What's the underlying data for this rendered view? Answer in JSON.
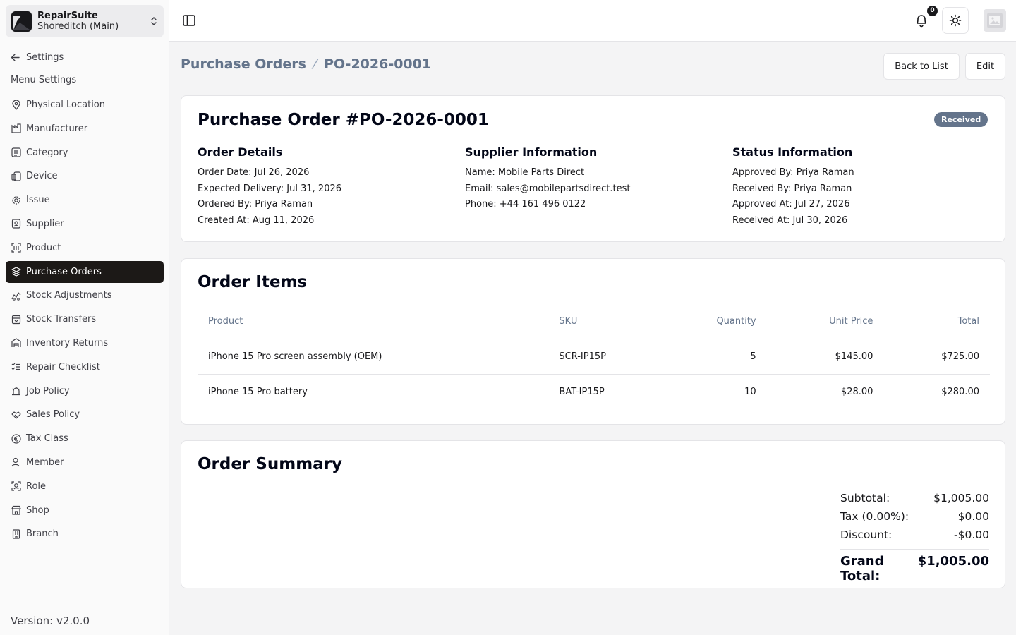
{
  "shop": {
    "name": "RepairSuite",
    "branch": "Shoreditch (Main)"
  },
  "sidebar": {
    "back_label": "Settings",
    "menu_heading": "Menu Settings",
    "items": [
      {
        "label": "Physical Location",
        "icon": "map-pin-icon"
      },
      {
        "label": "Manufacturer",
        "icon": "factory-icon"
      },
      {
        "label": "Category",
        "icon": "list-icon"
      },
      {
        "label": "Device",
        "icon": "device-icon"
      },
      {
        "label": "Issue",
        "icon": "gear-icon"
      },
      {
        "label": "Supplier",
        "icon": "contact-icon"
      },
      {
        "label": "Product",
        "icon": "barcode-icon"
      },
      {
        "label": "Purchase Orders",
        "icon": "layers-icon",
        "active": true
      },
      {
        "label": "Stock Adjustments",
        "icon": "adjust-icon"
      },
      {
        "label": "Stock Transfers",
        "icon": "transfer-icon"
      },
      {
        "label": "Inventory Returns",
        "icon": "warehouse-icon"
      },
      {
        "label": "Repair Checklist",
        "icon": "checklist-icon"
      },
      {
        "label": "Job Policy",
        "icon": "siren-icon"
      },
      {
        "label": "Sales Policy",
        "icon": "handshake-icon"
      },
      {
        "label": "Tax Class",
        "icon": "euro-icon"
      },
      {
        "label": "Member",
        "icon": "user-icon"
      },
      {
        "label": "Role",
        "icon": "role-icon"
      },
      {
        "label": "Shop",
        "icon": "store-icon"
      },
      {
        "label": "Branch",
        "icon": "building-icon"
      }
    ],
    "version": "Version: v2.0.0"
  },
  "topbar": {
    "notification_count": "0"
  },
  "breadcrumb": {
    "parent": "Purchase Orders",
    "current": "PO-2026-0001"
  },
  "actions": {
    "back": "Back to List",
    "edit": "Edit"
  },
  "order": {
    "title": "Purchase Order #PO-2026-0001",
    "status": "Received",
    "details": {
      "heading": "Order Details",
      "rows": [
        "Order Date: Jul 26, 2026",
        "Expected Delivery: Jul 31, 2026",
        "Ordered By: Priya Raman",
        "Created At: Aug 11, 2026"
      ]
    },
    "supplier": {
      "heading": "Supplier Information",
      "rows": [
        "Name: Mobile Parts Direct",
        "Email: sales@mobilepartsdirect.test",
        "Phone: +44 161 496 0122"
      ]
    },
    "status_info": {
      "heading": "Status Information",
      "rows": [
        "Approved By: Priya Raman",
        "Received By: Priya Raman",
        "Approved At: Jul 27, 2026",
        "Received At: Jul 30, 2026"
      ]
    }
  },
  "items": {
    "title": "Order Items",
    "columns": [
      "Product",
      "SKU",
      "Quantity",
      "Unit Price",
      "Total"
    ],
    "rows": [
      [
        "iPhone 15 Pro screen assembly (OEM)",
        "SCR-IP15P",
        "5",
        "$145.00",
        "$725.00"
      ],
      [
        "iPhone 15 Pro battery",
        "BAT-IP15P",
        "10",
        "$28.00",
        "$280.00"
      ]
    ]
  },
  "summary": {
    "title": "Order Summary",
    "subtotal_label": "Subtotal:",
    "subtotal": "$1,005.00",
    "tax_label": "Tax (0.00%):",
    "tax": "$0.00",
    "discount_label": "Discount:",
    "discount": "-$0.00",
    "grand_label": "Grand Total:",
    "grand": "$1,005.00"
  }
}
